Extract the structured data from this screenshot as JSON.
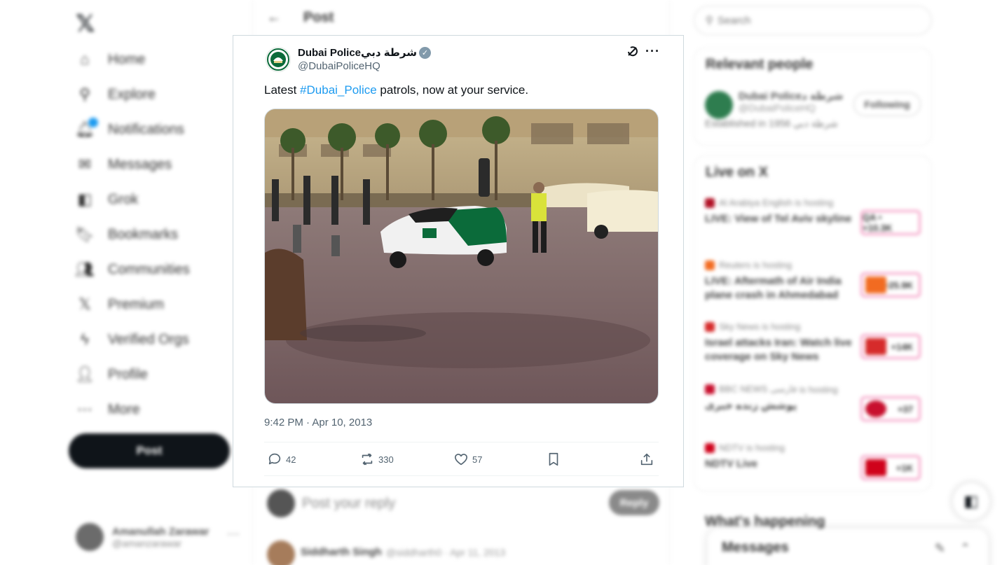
{
  "nav": {
    "logo": "𝕏",
    "items": [
      {
        "label": "Home",
        "icon": "home-icon"
      },
      {
        "label": "Explore",
        "icon": "search-icon"
      },
      {
        "label": "Notifications",
        "icon": "bell-icon"
      },
      {
        "label": "Messages",
        "icon": "envelope-icon"
      },
      {
        "label": "Grok",
        "icon": "grok-icon"
      },
      {
        "label": "Bookmarks",
        "icon": "bookmark-icon"
      },
      {
        "label": "Communities",
        "icon": "communities-icon"
      },
      {
        "label": "Premium",
        "icon": "x-premium-icon"
      },
      {
        "label": "Verified Orgs",
        "icon": "lightning-icon"
      },
      {
        "label": "Profile",
        "icon": "person-icon"
      },
      {
        "label": "More",
        "icon": "more-circle-icon"
      }
    ],
    "post_button": "Post",
    "account": {
      "name": "Amanullah Zarawar",
      "handle": "@amanzarawar"
    }
  },
  "center": {
    "title": "Post",
    "reply_placeholder": "Post your reply",
    "reply_button": "Reply",
    "next_tweet": {
      "name": "Siddharth Singh",
      "meta": "@siddharth0 · Apr 11, 2013"
    }
  },
  "tweet": {
    "author_name": "Dubai Policeشرطة دبي",
    "author_handle": "@DubaiPoliceHQ",
    "text_before": "Latest ",
    "hashtag": "#Dubai_Police",
    "text_after": " patrols, now at your service.",
    "timestamp": "9:42 PM · Apr 10, 2013",
    "replies": "42",
    "reposts": "330",
    "likes": "57",
    "colors": {
      "link": "#1d9bf0",
      "muted": "#536471",
      "police_green": "#0b6b3a"
    }
  },
  "sidebar": {
    "search_placeholder": "Search",
    "relevant_title": "Relevant people",
    "relevant": {
      "name": "Dubai Policeشرطة د",
      "handle": "@DubaiPoliceHQ",
      "bio": "Established in 1956 شرطة دبي",
      "button": "Following"
    },
    "live_title": "Live on X",
    "live": [
      {
        "source": "Al Arabiya English",
        "status": "is hosting",
        "title": "LIVE: View of Tel Aviv skyline",
        "thumb_label": "QA • +10.3K",
        "color": "#b11226"
      },
      {
        "source": "Reuters",
        "status": "is hosting",
        "title": "LIVE: Aftermath of Air India plane crash in Ahmedabad",
        "thumb_label": "+25.9K",
        "color": "#f26b21"
      },
      {
        "source": "Sky News",
        "status": "is hosting",
        "title": "Israel attacks Iran: Watch live coverage on Sky News",
        "thumb_label": "+14K",
        "color": "#d62b2b"
      },
      {
        "source": "BBC NEWS فارسی",
        "status": "is hosting",
        "title": "پوشش زنده خبری",
        "thumb_label": "+37",
        "color": "#c8102e"
      },
      {
        "source": "NDTV",
        "status": "is hosting",
        "title": "NDTV Live",
        "thumb_label": "+1K",
        "color": "#d0021b"
      }
    ],
    "happening_title": "What's happening",
    "messages_drawer": "Messages"
  }
}
